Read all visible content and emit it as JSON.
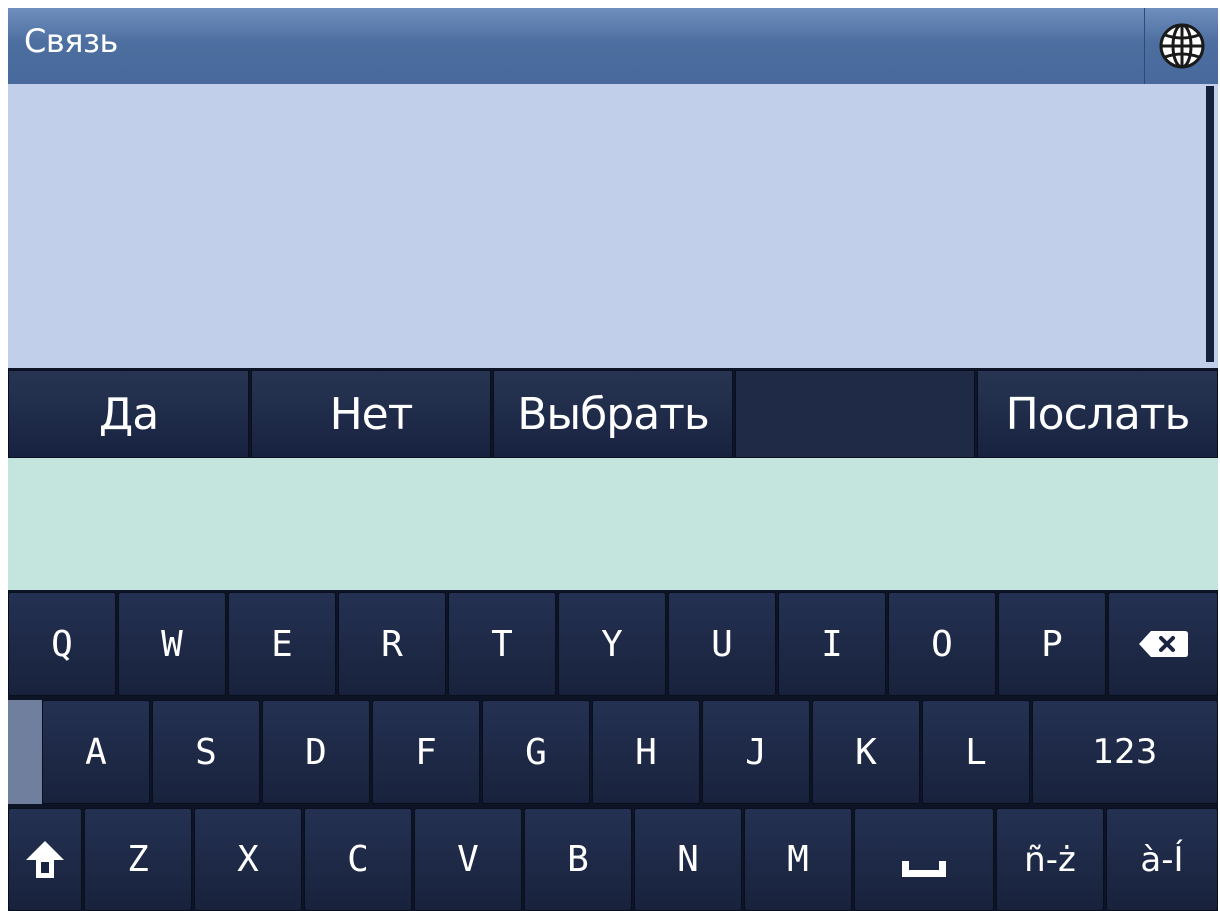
{
  "header": {
    "title": "Связь",
    "globe_icon": "globe-icon"
  },
  "actions": {
    "yes": "Да",
    "no": "Нет",
    "select": "Выбрать",
    "send": "Послать"
  },
  "keyboard": {
    "row1": [
      "Q",
      "W",
      "E",
      "R",
      "T",
      "Y",
      "U",
      "I",
      "O",
      "P"
    ],
    "row2": [
      "A",
      "S",
      "D",
      "F",
      "G",
      "H",
      "J",
      "K",
      "L"
    ],
    "numbers_label": "123",
    "row3": [
      "Z",
      "X",
      "C",
      "V",
      "B",
      "N",
      "M"
    ],
    "accent_label_1": "ñ-ż",
    "accent_label_2": "à-Í",
    "backspace_icon": "backspace-icon",
    "shift_icon": "shift-icon",
    "space_icon": "space-icon"
  },
  "colors": {
    "titlebar": "#4d6fa0",
    "message_area": "#c2cfeb",
    "input_area": "#c4e4de",
    "key_background": "#1e2a48"
  }
}
